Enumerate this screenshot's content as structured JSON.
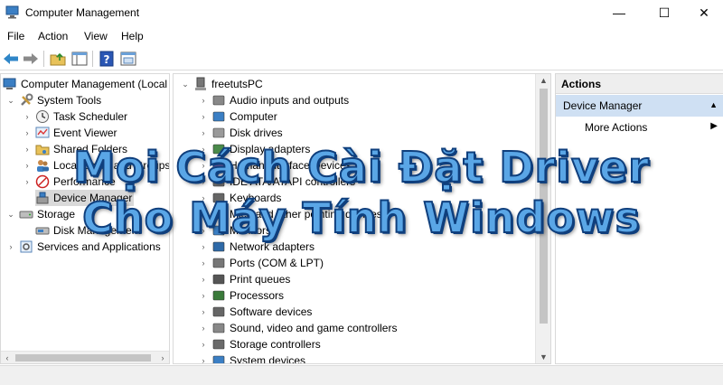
{
  "window": {
    "title": "Computer Management",
    "minimize_glyph": "—",
    "maximize_glyph": "☐",
    "close_glyph": "✕"
  },
  "menu": [
    "File",
    "Action",
    "View",
    "Help"
  ],
  "toolbar_icons": [
    "back-arrow-icon",
    "forward-arrow-icon",
    "up-folder-icon",
    "show-hide-tree-icon",
    "help-icon",
    "properties-icon"
  ],
  "left_tree": {
    "root": "Computer Management (Local",
    "items": [
      {
        "label": "System Tools",
        "icon": "tools-icon"
      },
      {
        "label": "Task Scheduler",
        "icon": "clock-icon"
      },
      {
        "label": "Event Viewer",
        "icon": "event-viewer-icon"
      },
      {
        "label": "Shared Folders",
        "icon": "shared-folder-icon"
      },
      {
        "label": "Local Users and Groups",
        "icon": "users-icon"
      },
      {
        "label": "Performance",
        "icon": "performance-icon"
      },
      {
        "label": "Device Manager",
        "icon": "device-manager-icon"
      },
      {
        "label": "Storage",
        "icon": "storage-icon"
      },
      {
        "label": "Disk Management",
        "icon": "disk-management-icon"
      },
      {
        "label": "Services and Applications",
        "icon": "services-icon"
      }
    ]
  },
  "device_tree": {
    "root": "freetutsPC",
    "items": [
      "Audio inputs and outputs",
      "Computer",
      "Disk drives",
      "Display adapters",
      "Human Interface Devices",
      "IDE ATA/ATAPI controllers",
      "Keyboards",
      "Mice and other pointing devices",
      "Monitors",
      "Network adapters",
      "Ports (COM & LPT)",
      "Print queues",
      "Processors",
      "Software devices",
      "Sound, video and game controllers",
      "Storage controllers",
      "System devices"
    ]
  },
  "actions": {
    "header": "Actions",
    "group": "Device Manager",
    "more": "More Actions"
  },
  "overlay": {
    "line1": "Mọi Cách Cài Đặt Driver",
    "line2": "Cho Máy Tính Windows"
  },
  "colors": {
    "overlay_fill": "#5aa6e6",
    "overlay_stroke": "#0f3f7d",
    "actions_group_bg": "#cfe0f3"
  }
}
